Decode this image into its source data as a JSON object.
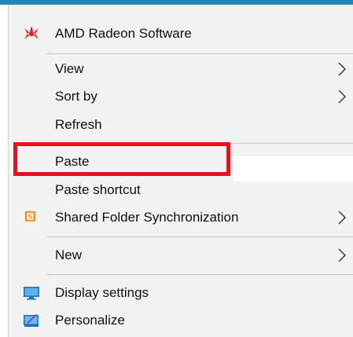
{
  "menu": {
    "items": [
      {
        "label": "AMD Radeon Software",
        "icon": "amd-radeon-icon"
      },
      {
        "label": "View",
        "submenu": true
      },
      {
        "label": "Sort by",
        "submenu": true
      },
      {
        "label": "Refresh"
      },
      {
        "label": "Paste",
        "highlighted": true
      },
      {
        "label": "Paste shortcut"
      },
      {
        "label": "Shared Folder Synchronization",
        "icon": "shared-folder-icon",
        "submenu": true
      },
      {
        "label": "New",
        "submenu": true
      },
      {
        "label": "Display settings",
        "icon": "display-icon"
      },
      {
        "label": "Personalize",
        "icon": "personalize-icon"
      }
    ]
  },
  "colors": {
    "menu_bg": "#f2f2f2",
    "accent_top": "#1e88b8",
    "highlight_box": "#e8101f",
    "amd_red": "#e01f26",
    "shared_folder_orange": "#f08a24"
  }
}
